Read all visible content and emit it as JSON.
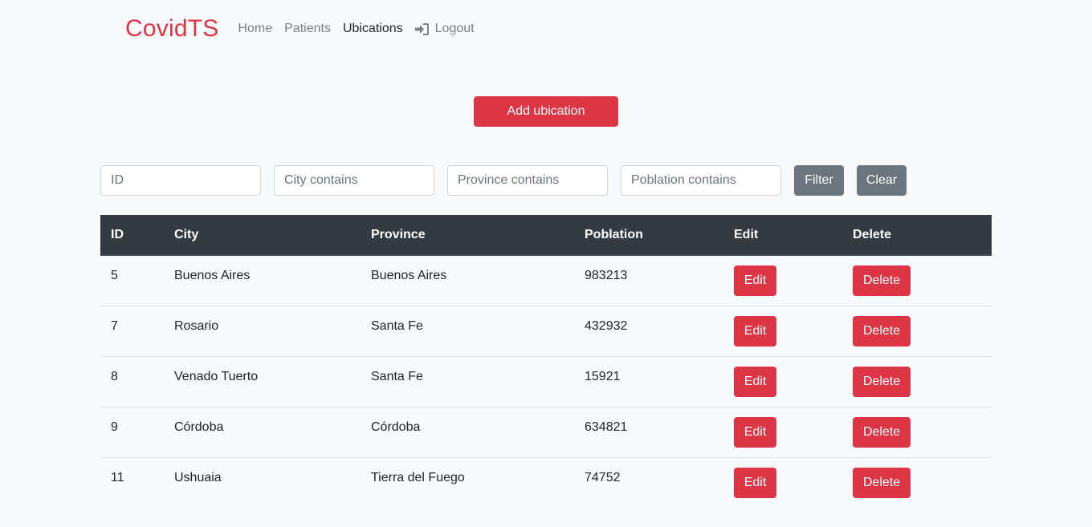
{
  "nav": {
    "brand": "CovidTS",
    "links": [
      {
        "label": "Home"
      },
      {
        "label": "Patients"
      },
      {
        "label": "Ubications"
      },
      {
        "label": "Logout",
        "icon": "sign-in-icon"
      }
    ]
  },
  "add_button": "Add ubication",
  "filters": {
    "id_placeholder": "ID",
    "city_placeholder": "City contains",
    "province_placeholder": "Province contains",
    "poblation_placeholder": "Poblation contains",
    "filter_label": "Filter",
    "clear_label": "Clear"
  },
  "table": {
    "headers": [
      "ID",
      "City",
      "Province",
      "Poblation",
      "Edit",
      "Delete"
    ],
    "edit_label": "Edit",
    "delete_label": "Delete",
    "rows": [
      {
        "id": "5",
        "city": "Buenos Aires",
        "province": "Buenos Aires",
        "poblation": "983213"
      },
      {
        "id": "7",
        "city": "Rosario",
        "province": "Santa Fe",
        "poblation": "432932"
      },
      {
        "id": "8",
        "city": "Venado Tuerto",
        "province": "Santa Fe",
        "poblation": "15921"
      },
      {
        "id": "9",
        "city": "Córdoba",
        "province": "Córdoba",
        "poblation": "634821"
      },
      {
        "id": "11",
        "city": "Ushuaia",
        "province": "Tierra del Fuego",
        "poblation": "74752"
      }
    ]
  },
  "colors": {
    "brand": "#dc3545",
    "danger": "#dc3545",
    "secondary": "#6c757d",
    "table_header": "#343a40",
    "background": "#f8f9fa"
  }
}
